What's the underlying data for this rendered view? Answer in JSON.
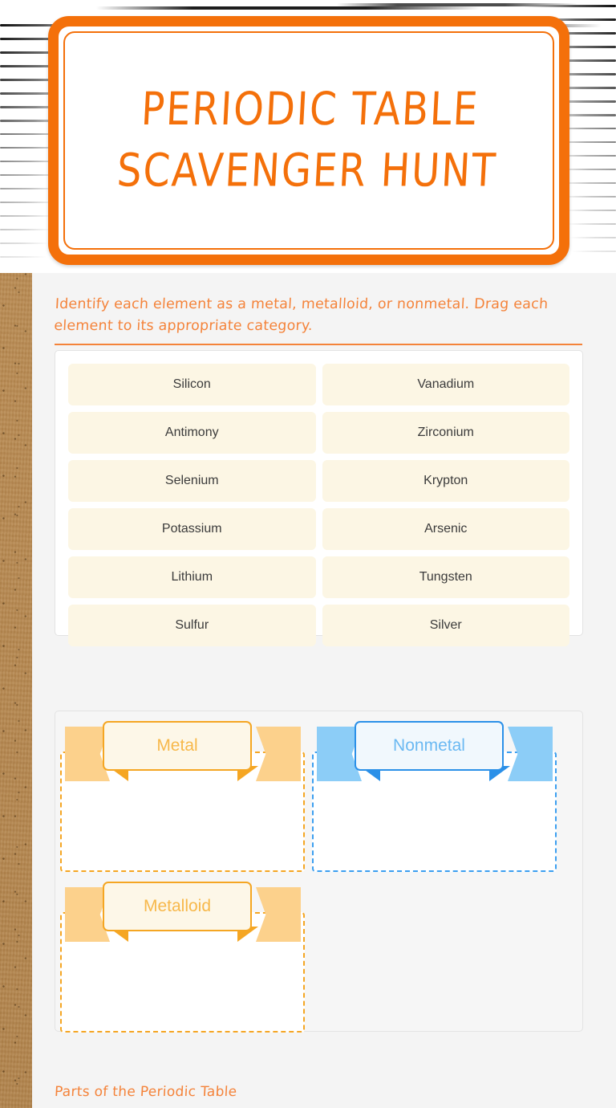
{
  "header": {
    "title_line1": "Periodic Table",
    "title_line2": "Scavenger Hunt"
  },
  "instruction": {
    "text": "Identify each element as a metal, metalloid, or nonmetal. Drag each element to its appropriate category."
  },
  "elements": {
    "items": [
      "Silicon",
      "Vanadium",
      "Antimony",
      "Zirconium",
      "Selenium",
      "Krypton",
      "Potassium",
      "Arsenic",
      "Lithium",
      "Tungsten",
      "Sulfur",
      "Silver"
    ]
  },
  "categories": [
    {
      "label": "Metal",
      "theme": "orange"
    },
    {
      "label": "Nonmetal",
      "theme": "blue"
    },
    {
      "label": "Metalloid",
      "theme": "orange"
    }
  ],
  "footer": {
    "text": "Parts of the Periodic Table"
  },
  "colors": {
    "brand_orange": "#f4700a",
    "instruction_orange": "#f4833a",
    "chip_bg": "#fcf6e4",
    "chip_text": "#3b3b3b",
    "category_orange": "#f5a623",
    "category_orange_light": "#fcd18c",
    "category_blue": "#2b90e8",
    "category_blue_light": "#8ccdf7",
    "panel_bg": "#f4f4f4",
    "paper_bg": "#b98b52"
  }
}
